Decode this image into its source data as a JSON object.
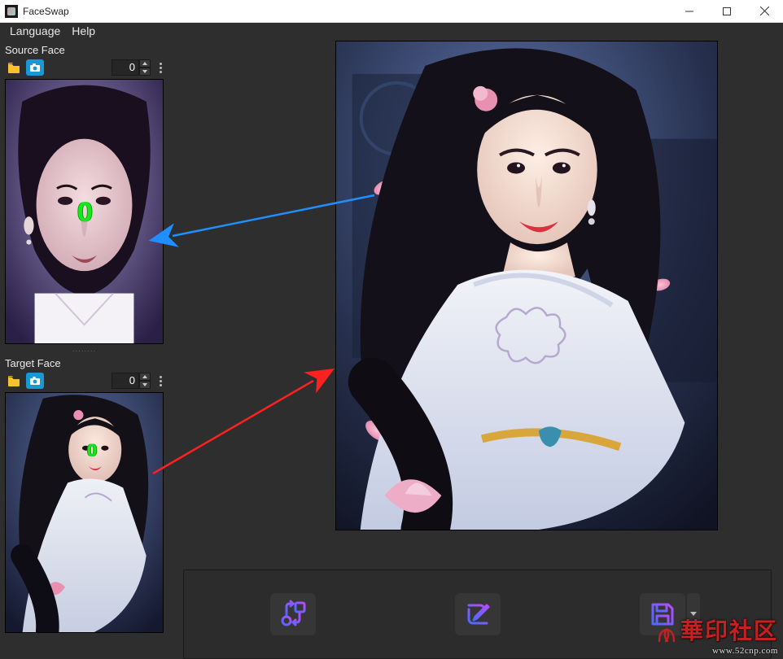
{
  "window": {
    "title": "FaceSwap"
  },
  "menu": {
    "language": "Language",
    "help": "Help"
  },
  "sidebar": {
    "source": {
      "label": "Source Face",
      "index": "0",
      "marker": "0"
    },
    "target": {
      "label": "Target Face",
      "index": "0",
      "marker": "0"
    }
  },
  "actions": {
    "swap": "swap-icon",
    "edit": "edit-icon",
    "save": "save-icon"
  },
  "watermark": {
    "brand": "華印社区",
    "url": "www.52cnp.com"
  },
  "colors": {
    "accent_blue": "#1898d4",
    "marker_green": "#17e81d",
    "arrow_blue": "#1f8fff",
    "arrow_red": "#ff2020"
  }
}
